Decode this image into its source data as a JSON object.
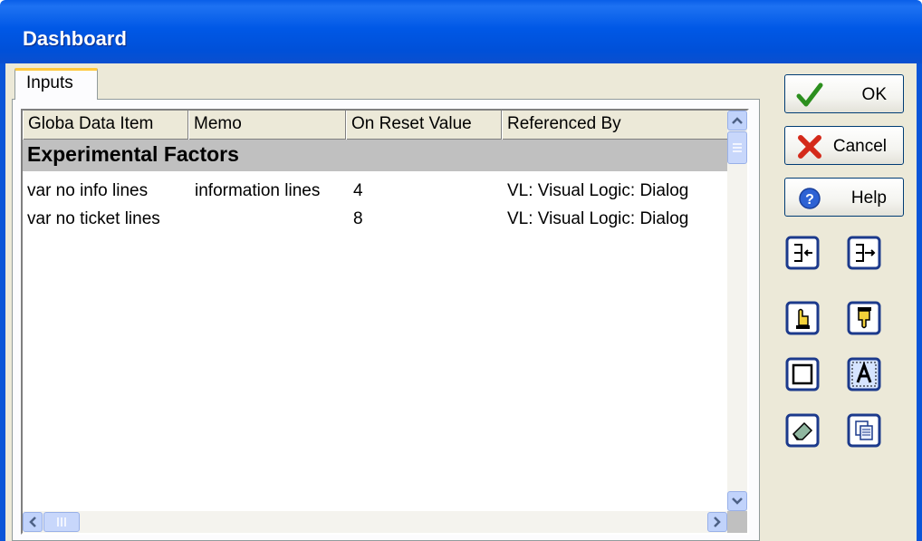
{
  "window": {
    "title": "Dashboard"
  },
  "tabs": [
    {
      "label": "Inputs"
    }
  ],
  "grid": {
    "columns": [
      "Globa Data Item",
      "Memo",
      "On Reset Value",
      "Referenced By"
    ],
    "group_label": "Experimental Factors",
    "rows": [
      {
        "item": "var no info lines",
        "memo": "information lines",
        "reset": "4",
        "ref": "VL: Visual Logic:  Dialog"
      },
      {
        "item": "var no ticket lines",
        "memo": "",
        "reset": "8",
        "ref": "VL: Visual Logic:  Dialog"
      }
    ]
  },
  "buttons": {
    "ok": "OK",
    "cancel": "Cancel",
    "help": "Help"
  },
  "tools": [
    "import-data-icon",
    "export-data-icon",
    "hand-up-icon",
    "hand-down-icon",
    "frame-icon",
    "text-icon",
    "eraser-icon",
    "copy-icon"
  ],
  "colors": {
    "titlebar": "#0058e6",
    "group_band": "#c0c0c0",
    "tab_highlight": "#ffc83c"
  }
}
